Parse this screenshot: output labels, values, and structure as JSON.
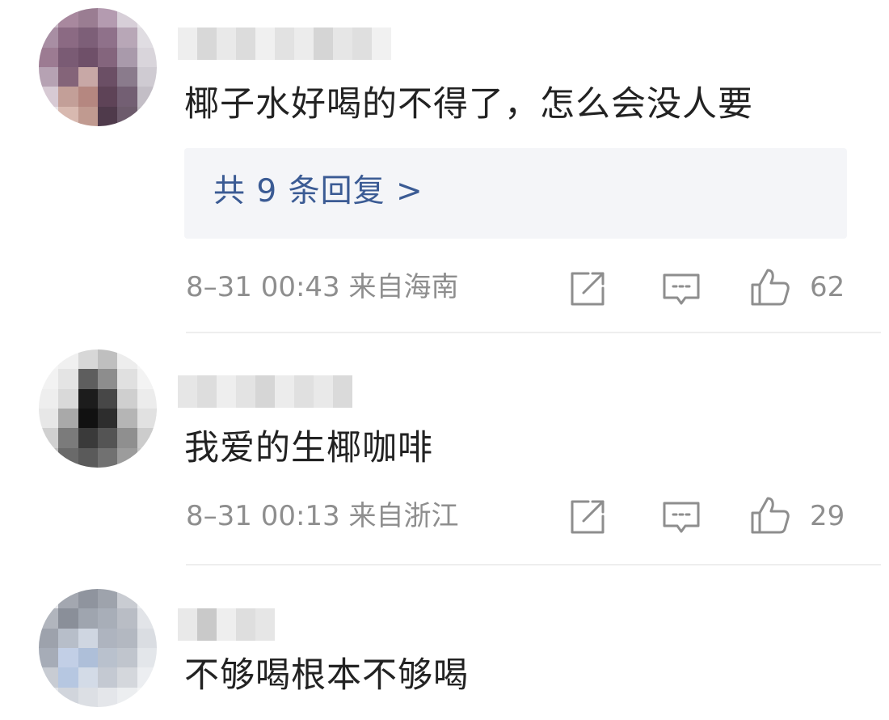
{
  "comments": [
    {
      "content": "椰子水好喝的不得了，怎么会没人要",
      "reply_link": "共 9 条回复 >",
      "time": "8–31 00:43",
      "location": "来自海南",
      "likes": "62",
      "icons": {
        "share": "share-icon",
        "comment": "comment-icon",
        "like": "thumbs-up-icon"
      }
    },
    {
      "content": "我爱的生椰咖啡",
      "time": "8–31 00:13",
      "location": "来自浙江",
      "likes": "29",
      "icons": {
        "share": "share-icon",
        "comment": "comment-icon",
        "like": "thumbs-up-icon"
      }
    },
    {
      "content": "不够喝根本不够喝"
    }
  ],
  "colors": {
    "text": "#222222",
    "meta": "#8e8e8e",
    "link": "#3b5b94",
    "reply_bg": "#f4f5f8",
    "divider": "#eeeeee"
  }
}
